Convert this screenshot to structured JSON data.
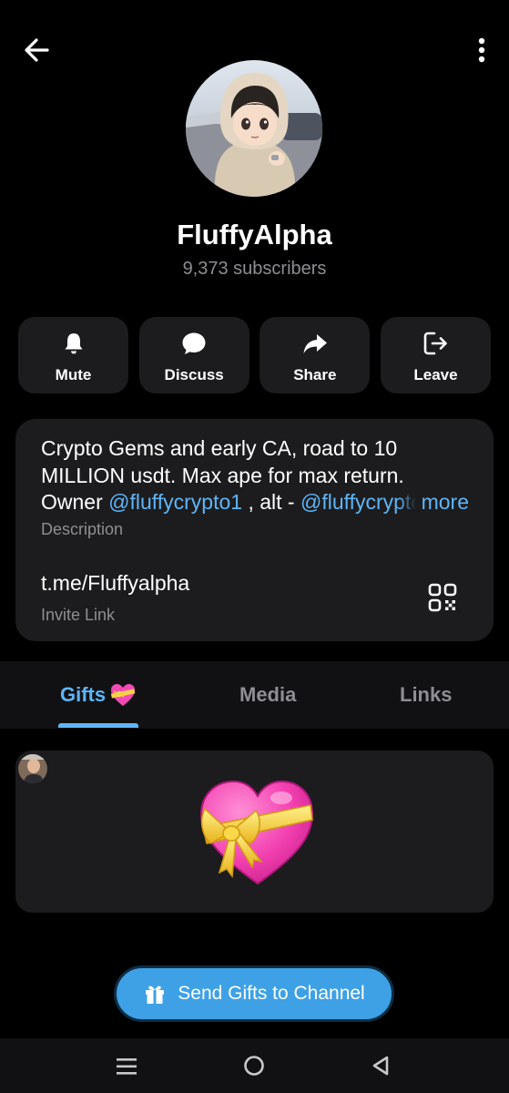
{
  "header": {
    "back_icon": "arrow-left-icon",
    "menu_icon": "vertical-dots-icon"
  },
  "profile": {
    "name": "FluffyAlpha",
    "subscribers": "9,373 subscribers"
  },
  "actions": [
    {
      "label": "Mute",
      "icon": "bell-icon"
    },
    {
      "label": "Discuss",
      "icon": "chat-bubble-icon"
    },
    {
      "label": "Share",
      "icon": "share-arrow-icon"
    },
    {
      "label": "Leave",
      "icon": "leave-icon"
    }
  ],
  "info": {
    "description_line1": "Crypto Gems and early CA, road to 10",
    "description_line2": "MILLION usdt. Max ape for max return.",
    "description_owner_prefix": "Owner ",
    "description_mention1": "@fluffycrypto1",
    "description_alt": " , alt - ",
    "description_mention2": "@fluffycrypto",
    "more_label": "more",
    "description_caption": "Description",
    "invite_link": "t.me/Fluffyalpha",
    "invite_caption": "Invite Link",
    "qr_icon": "qr-code-icon"
  },
  "tabs": [
    {
      "label": "Gifts",
      "active": true,
      "emoji": "heart-with-ribbon"
    },
    {
      "label": "Media",
      "active": false
    },
    {
      "label": "Links",
      "active": false
    }
  ],
  "gift": {
    "item_icon": "heart-with-ribbon-icon"
  },
  "send_button": {
    "label": "Send Gifts to Channel",
    "icon": "gift-icon"
  },
  "colors": {
    "accent": "#5eb5f7",
    "button_blue": "#3ea1e6",
    "card_bg": "#1c1c1e",
    "muted_text": "#8e8e93"
  }
}
